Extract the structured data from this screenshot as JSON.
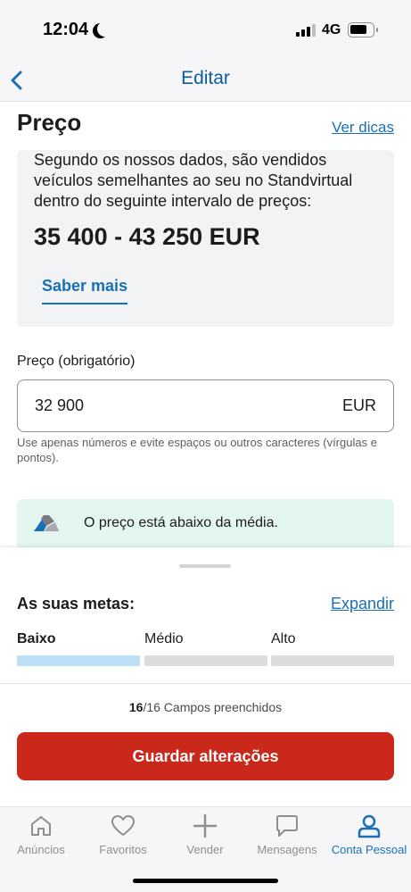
{
  "status_bar": {
    "time": "12:04",
    "network": "4G",
    "moon_icon": "moon-icon",
    "signal_icon": "cellular-signal-icon",
    "battery_icon": "battery-icon"
  },
  "nav": {
    "title": "Editar",
    "back_icon": "chevron-left-icon"
  },
  "price_section": {
    "title": "Preço",
    "tips_link": "Ver dicas",
    "info_text": "Segundo os nossos dados, são vendidos veículos semelhantes ao seu no Standvirtual dentro do seguinte intervalo de preços:",
    "price_range": "35 400 - 43 250 EUR",
    "learn_more": "Saber mais"
  },
  "price_input": {
    "label": "Preço (obrigatório)",
    "value": "32 900",
    "unit": "EUR",
    "hint": "Use apenas números e evite espaços ou outros caracteres (vírgulas e pontos)."
  },
  "price_evaluation": {
    "text": "O preço está abaixo da média.",
    "icon": "price-gauge-icon"
  },
  "goals": {
    "title": "As suas metas:",
    "expand_link": "Expandir",
    "levels": [
      {
        "label": "Baixo",
        "active": true
      },
      {
        "label": "Médio",
        "active": false
      },
      {
        "label": "Alto",
        "active": false
      }
    ]
  },
  "progress": {
    "filled": "16",
    "total": "/16",
    "suffix": " Campos preenchidos"
  },
  "save_button": "Guardar alterações",
  "tabs": [
    {
      "label": "Anúncios",
      "icon": "home-icon",
      "active": false
    },
    {
      "label": "Favoritos",
      "icon": "heart-icon",
      "active": false
    },
    {
      "label": "Vender",
      "icon": "plus-icon",
      "active": false
    },
    {
      "label": "Mensagens",
      "icon": "chat-bubble-icon",
      "active": false
    },
    {
      "label": "Conta Pessoal",
      "icon": "user-icon",
      "active": true
    }
  ],
  "colors": {
    "accent": "#1b6fb6",
    "nav_title": "#0e5b9b",
    "primary_button": "#c9281b",
    "evaluation_bg": "#e3f7f0",
    "goal_active": "#bcdff8"
  }
}
